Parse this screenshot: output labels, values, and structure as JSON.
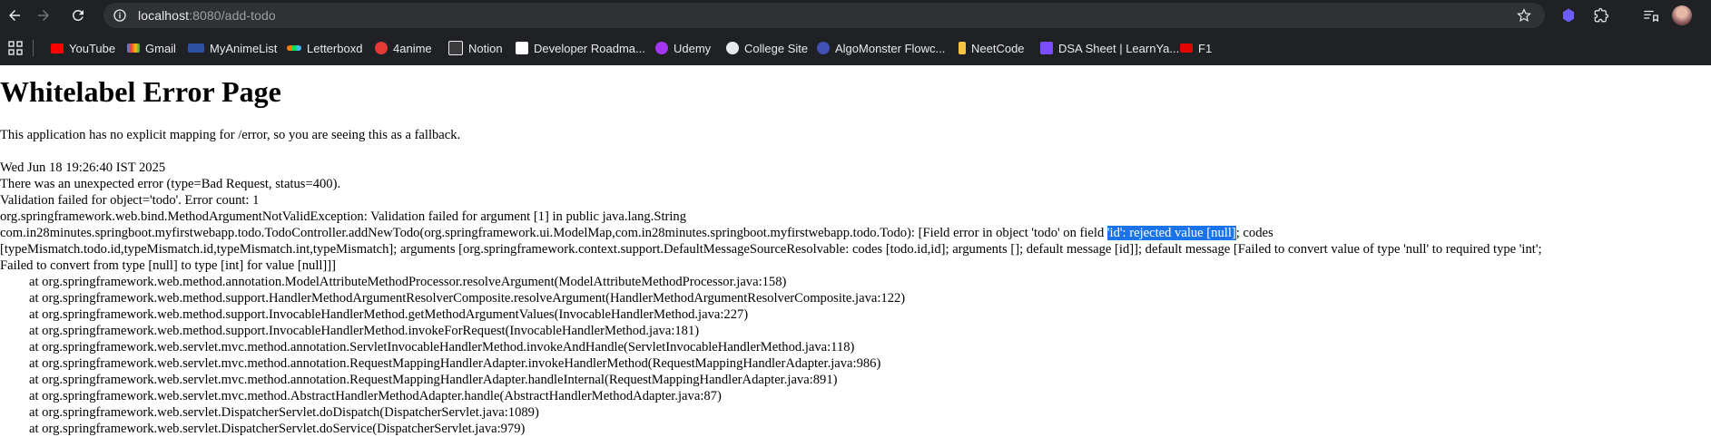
{
  "browser": {
    "url_host": "localhost",
    "url_path": ":8080/add-todo",
    "bookmarks": [
      {
        "label": "YouTube",
        "icon": "youtube-icon",
        "color": "#ff0000"
      },
      {
        "label": "Gmail",
        "icon": "gmail-icon",
        "color": "#ea4335"
      },
      {
        "label": "MyAnimeList",
        "icon": "myanimelist-icon",
        "color": "#2e51a2"
      },
      {
        "label": "Letterboxd",
        "icon": "letterboxd-icon",
        "color": "#00c030"
      },
      {
        "label": "4anime",
        "icon": "4anime-icon",
        "color": "#e53935"
      },
      {
        "label": "Notion",
        "icon": "notion-icon",
        "color": "#ffffff"
      },
      {
        "label": "Developer Roadma...",
        "icon": "roadmap-icon",
        "color": "#000000"
      },
      {
        "label": "Udemy",
        "icon": "udemy-icon",
        "color": "#a435f0"
      },
      {
        "label": "College Site",
        "icon": "globe-icon",
        "color": "#9aa0a6"
      },
      {
        "label": "AlgoMonster Flowc...",
        "icon": "algomonster-icon",
        "color": "#3f51b5"
      },
      {
        "label": "NeetCode",
        "icon": "neetcode-icon",
        "color": "#f5c542"
      },
      {
        "label": "DSA Sheet | LearnYa...",
        "icon": "learnyard-icon",
        "color": "#7c4dff"
      },
      {
        "label": "F1",
        "icon": "f1-icon",
        "color": "#e10600"
      }
    ]
  },
  "page": {
    "title": "Whitelabel Error Page",
    "intro": "This application has no explicit mapping for /error, so you are seeing this as a fallback.",
    "timestamp": "Wed Jun 18 19:26:40 IST 2025",
    "error_line": "There was an unexpected error (type=Bad Request, status=400).",
    "validation_line": "Validation failed for object='todo'. Error count: 1",
    "exception_line": "org.springframework.web.bind.MethodArgumentNotValidException: Validation failed for argument [1] in public java.lang.String",
    "detail_pre": "com.in28minutes.springboot.myfirstwebapp.todo.TodoController.addNewTodo(org.springframework.ui.ModelMap,com.in28minutes.springboot.myfirstwebapp.todo.Todo): [Field error in object 'todo' on field ",
    "detail_selected": "'id': rejected value [null]",
    "detail_post": "; codes",
    "detail_line3": "[typeMismatch.todo.id,typeMismatch.id,typeMismatch.int,typeMismatch]; arguments [org.springframework.context.support.DefaultMessageSourceResolvable: codes [todo.id,id]; arguments []; default message [id]]; default message [Failed to convert value of type 'null' to required type 'int';",
    "detail_line4": "Failed to convert from type [null] to type [int] for value [null]]]",
    "stack": [
      "at org.springframework.web.method.annotation.ModelAttributeMethodProcessor.resolveArgument(ModelAttributeMethodProcessor.java:158)",
      "at org.springframework.web.method.support.HandlerMethodArgumentResolverComposite.resolveArgument(HandlerMethodArgumentResolverComposite.java:122)",
      "at org.springframework.web.method.support.InvocableHandlerMethod.getMethodArgumentValues(InvocableHandlerMethod.java:227)",
      "at org.springframework.web.method.support.InvocableHandlerMethod.invokeForRequest(InvocableHandlerMethod.java:181)",
      "at org.springframework.web.servlet.mvc.method.annotation.ServletInvocableHandlerMethod.invokeAndHandle(ServletInvocableHandlerMethod.java:118)",
      "at org.springframework.web.servlet.mvc.method.annotation.RequestMappingHandlerAdapter.invokeHandlerMethod(RequestMappingHandlerAdapter.java:986)",
      "at org.springframework.web.servlet.mvc.method.annotation.RequestMappingHandlerAdapter.handleInternal(RequestMappingHandlerAdapter.java:891)",
      "at org.springframework.web.servlet.mvc.method.AbstractHandlerMethodAdapter.handle(AbstractHandlerMethodAdapter.java:87)",
      "at org.springframework.web.servlet.DispatcherServlet.doDispatch(DispatcherServlet.java:1089)",
      "at org.springframework.web.servlet.DispatcherServlet.doService(DispatcherServlet.java:979)"
    ]
  }
}
